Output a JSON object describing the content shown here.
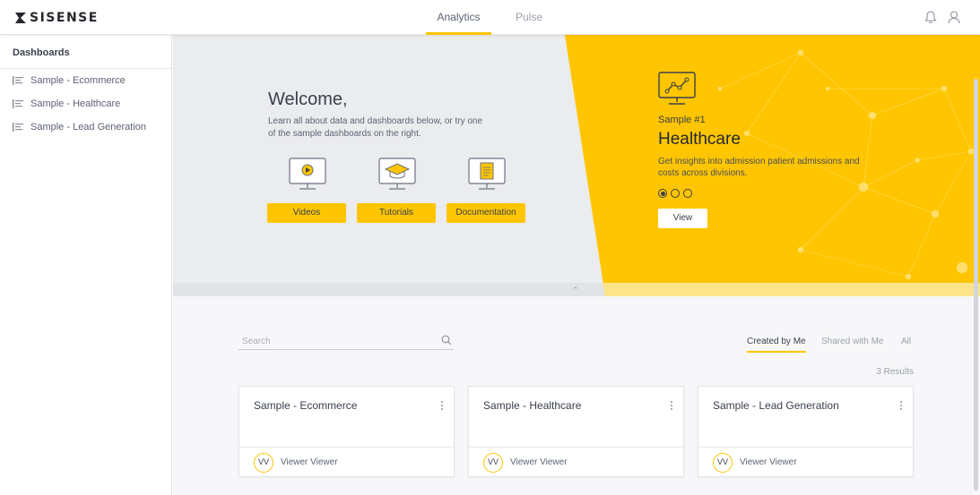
{
  "app": {
    "logo_text": "SISENSE"
  },
  "header": {
    "tabs": [
      {
        "label": "Analytics",
        "active": true
      },
      {
        "label": "Pulse",
        "active": false
      }
    ],
    "icons": [
      "bell-icon",
      "user-icon"
    ]
  },
  "sidebar": {
    "title": "Dashboards",
    "items": [
      {
        "label": "Sample - Ecommerce"
      },
      {
        "label": "Sample - Healthcare"
      },
      {
        "label": "Sample - Lead Generation"
      }
    ]
  },
  "welcome": {
    "title": "Welcome,",
    "text": "Learn all about data and dashboards below, or try one of the sample dashboards on the right.",
    "resources": [
      {
        "label": "Videos",
        "icon": "video-monitor-icon"
      },
      {
        "label": "Tutorials",
        "icon": "graduation-cap-monitor-icon"
      },
      {
        "label": "Documentation",
        "icon": "document-monitor-icon"
      }
    ]
  },
  "sample": {
    "number": "Sample #1",
    "name": "Healthcare",
    "description": "Get insights into admission patient admissions and costs across divisions.",
    "carousel_total": 3,
    "carousel_active": 1,
    "view_label": "View"
  },
  "search": {
    "placeholder": "Search",
    "value": ""
  },
  "filters": [
    {
      "label": "Created by Me",
      "active": true
    },
    {
      "label": "Shared with Me",
      "active": false
    },
    {
      "label": "All",
      "active": false
    }
  ],
  "results_text": "3 Results",
  "cards": [
    {
      "title": "Sample - Ecommerce",
      "owner_initials": "VV",
      "owner": "Viewer Viewer"
    },
    {
      "title": "Sample - Healthcare",
      "owner_initials": "VV",
      "owner": "Viewer Viewer"
    },
    {
      "title": "Sample - Lead Generation",
      "owner_initials": "VV",
      "owner": "Viewer Viewer"
    }
  ],
  "colors": {
    "accent": "#fec500",
    "hero_gray": "#ebecee",
    "text_dark": "#3a404d",
    "text_muted": "#9aa0ab"
  }
}
